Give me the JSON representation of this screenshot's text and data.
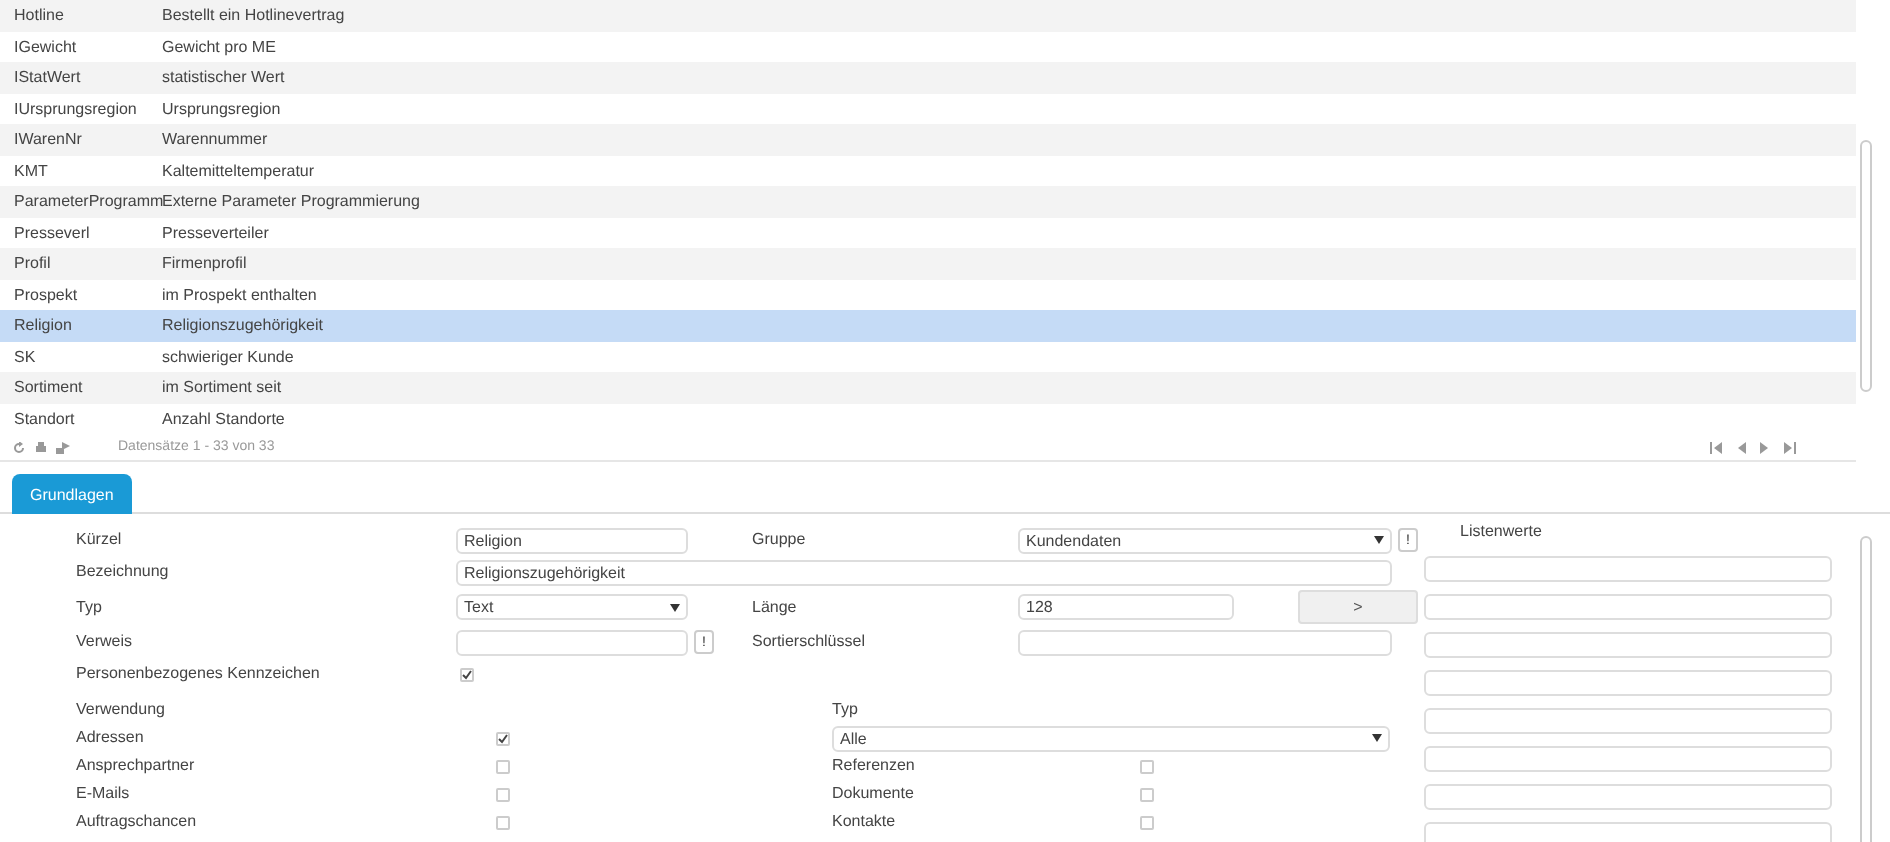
{
  "table": {
    "rows": [
      {
        "code": "Hotline",
        "description": "Bestellt ein Hotlinevertrag",
        "selected": false
      },
      {
        "code": "IGewicht",
        "description": "Gewicht pro ME",
        "selected": false
      },
      {
        "code": "IStatWert",
        "description": "statistischer Wert",
        "selected": false
      },
      {
        "code": "IUrsprungsregion",
        "description": "Ursprungsregion",
        "selected": false
      },
      {
        "code": "IWarenNr",
        "description": "Warennummer",
        "selected": false
      },
      {
        "code": "KMT",
        "description": "Kaltemitteltemperatur",
        "selected": false
      },
      {
        "code": "ParameterProgramm",
        "description": "Externe Parameter Programmierung",
        "selected": false
      },
      {
        "code": "Presseverl",
        "description": "Presseverteiler",
        "selected": false
      },
      {
        "code": "Profil",
        "description": "Firmenprofil",
        "selected": false
      },
      {
        "code": "Prospekt",
        "description": "im Prospekt enthalten",
        "selected": false
      },
      {
        "code": "Religion",
        "description": "Religionszugehörigkeit",
        "selected": true
      },
      {
        "code": "SK",
        "description": "schwieriger Kunde",
        "selected": false
      },
      {
        "code": "Sortiment",
        "description": "im Sortiment seit",
        "selected": false
      },
      {
        "code": "Standort",
        "description": "Anzahl Standorte",
        "selected": false
      }
    ],
    "record_info": "Datensätze 1 - 33 von 33"
  },
  "tabs": [
    {
      "label": "Grundlagen",
      "selected": true
    }
  ],
  "form": {
    "kuerzel": {
      "label": "Kürzel",
      "value": "Religion"
    },
    "gruppe": {
      "label": "Gruppe",
      "value": "Kundendaten",
      "button": "!"
    },
    "bezeichnung": {
      "label": "Bezeichnung",
      "value": "Religionszugehörigkeit"
    },
    "typ": {
      "label": "Typ",
      "value": "Text"
    },
    "laenge": {
      "label": "Länge",
      "value": "128",
      "button": ">"
    },
    "verweis": {
      "label": "Verweis",
      "button": "!"
    },
    "sortierschluessel": {
      "label": "Sortierschlüssel"
    },
    "personenbezogen": {
      "label": "Personenbezogenes Kennzeichen",
      "checked": true
    },
    "verwendung": {
      "label": "Verwendung",
      "items": [
        {
          "label": "Adressen",
          "checked": true
        },
        {
          "label": "Ansprechpartner",
          "checked": false
        },
        {
          "label": "E-Mails",
          "checked": false
        },
        {
          "label": "Auftragschancen",
          "checked": false
        }
      ]
    },
    "typ_filter": {
      "label": "Typ",
      "value": "Alle",
      "items": [
        {
          "label": "Referenzen",
          "checked": false
        },
        {
          "label": "Dokumente",
          "checked": false
        },
        {
          "label": "Kontakte",
          "checked": false
        }
      ]
    },
    "listenwerte": {
      "label": "Listenwerte"
    }
  }
}
